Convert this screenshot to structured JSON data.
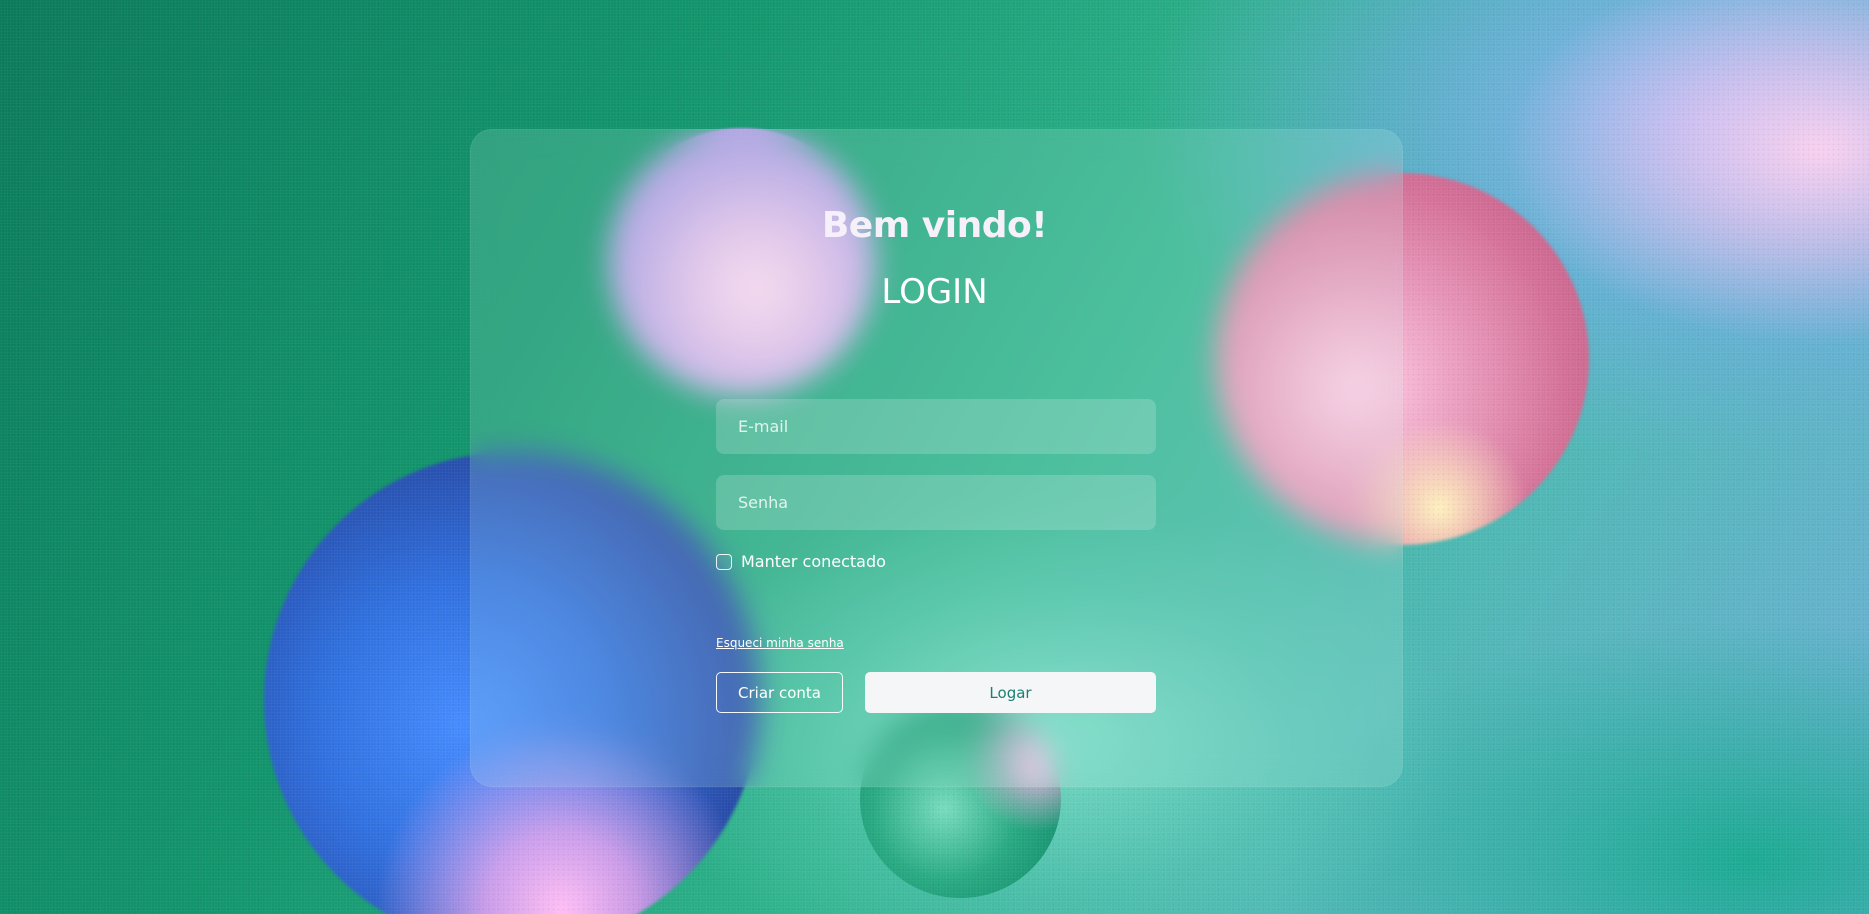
{
  "header": {
    "welcome": "Bem vindo!",
    "title": "LOGIN"
  },
  "form": {
    "email": {
      "placeholder": "E-mail",
      "value": ""
    },
    "password": {
      "placeholder": "Senha",
      "value": ""
    },
    "remember": {
      "label": "Manter conectado",
      "checked": false
    },
    "forgot_link": "Esqueci minha senha",
    "create_button": "Criar conta",
    "login_button": "Logar"
  },
  "colors": {
    "background_green": "#12956c",
    "background_blue": "#6fb0d8",
    "login_button_bg": "#f4f6f7",
    "login_button_text": "#1c7f74",
    "text": "#ffffff"
  }
}
